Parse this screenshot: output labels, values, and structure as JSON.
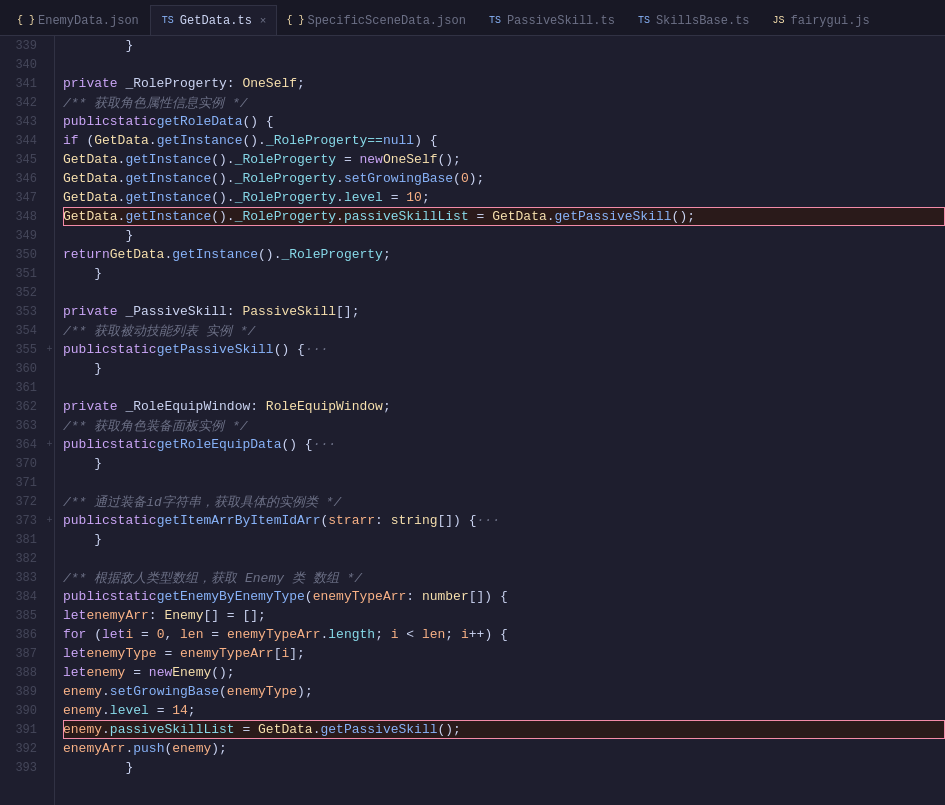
{
  "tabs": [
    {
      "id": "enemydata",
      "label": "EnemyData.json",
      "icon": "json",
      "active": false,
      "closeable": false,
      "color": "#f9e2af"
    },
    {
      "id": "getdata",
      "label": "GetData.ts",
      "icon": "ts",
      "active": true,
      "closeable": true,
      "color": "#89b4fa"
    },
    {
      "id": "specificscenedata",
      "label": "SpecificSceneData.json",
      "icon": "json",
      "active": false,
      "closeable": false,
      "color": "#f9e2af"
    },
    {
      "id": "passiveskill",
      "label": "PassiveSkill.ts",
      "icon": "ts",
      "active": false,
      "closeable": false,
      "color": "#89b4fa"
    },
    {
      "id": "skillsbase",
      "label": "SkillsBase.ts",
      "icon": "ts",
      "active": false,
      "closeable": false,
      "color": "#89b4fa"
    },
    {
      "id": "fairygui",
      "label": "fairygui.js",
      "icon": "js",
      "active": false,
      "closeable": false,
      "color": "#f9e2af"
    }
  ],
  "lines": [
    {
      "num": 339,
      "fold": false,
      "content": "        }"
    },
    {
      "num": 340,
      "fold": false,
      "content": ""
    },
    {
      "num": 341,
      "fold": false,
      "content": "    private _RoleProgerty: OneSelf;"
    },
    {
      "num": 342,
      "fold": false,
      "content": "    /** 获取角色属性信息实例 */"
    },
    {
      "num": 343,
      "fold": false,
      "content": "    public static getRoleData() {"
    },
    {
      "num": 344,
      "fold": false,
      "content": "        if (GetData.getInstance()._RoleProgerty == null) {"
    },
    {
      "num": 345,
      "fold": false,
      "content": "            GetData.getInstance()._RoleProgerty = new OneSelf();"
    },
    {
      "num": 346,
      "fold": false,
      "content": "            GetData.getInstance()._RoleProgerty.setGrowingBase(0);"
    },
    {
      "num": 347,
      "fold": false,
      "content": "            GetData.getInstance()._RoleProgerty.level = 10;"
    },
    {
      "num": 348,
      "fold": false,
      "content": "            GetData.getInstance()._RoleProgerty.passiveSkillList = GetData.getPassiveSkill();",
      "highlight": true
    },
    {
      "num": 349,
      "fold": false,
      "content": "        }"
    },
    {
      "num": 350,
      "fold": false,
      "content": "        return GetData.getInstance()._RoleProgerty;"
    },
    {
      "num": 351,
      "fold": false,
      "content": "    }"
    },
    {
      "num": 352,
      "fold": false,
      "content": ""
    },
    {
      "num": 353,
      "fold": false,
      "content": "    private _PassiveSkill: PassiveSkill[];"
    },
    {
      "num": 354,
      "fold": false,
      "content": "    /** 获取被动技能列表 实例 */"
    },
    {
      "num": 355,
      "fold": true,
      "content": "    public static getPassiveSkill() {···"
    },
    {
      "num": 360,
      "fold": false,
      "content": "    }"
    },
    {
      "num": 361,
      "fold": false,
      "content": ""
    },
    {
      "num": 362,
      "fold": false,
      "content": "    private _RoleEquipWindow: RoleEquipWindow;"
    },
    {
      "num": 363,
      "fold": false,
      "content": "    /** 获取角色装备面板实例 */"
    },
    {
      "num": 364,
      "fold": true,
      "content": "    public static getRoleEquipData() {···"
    },
    {
      "num": 370,
      "fold": false,
      "content": "    }"
    },
    {
      "num": 371,
      "fold": false,
      "content": ""
    },
    {
      "num": 372,
      "fold": false,
      "content": "    /** 通过装备id字符串，获取具体的实例类 */"
    },
    {
      "num": 373,
      "fold": true,
      "content": "    public static getItemArrByItemIdArr(strarr: string[]) {···"
    },
    {
      "num": 381,
      "fold": false,
      "content": "    }"
    },
    {
      "num": 382,
      "fold": false,
      "content": ""
    },
    {
      "num": 383,
      "fold": false,
      "content": "    /** 根据敌人类型数组，获取 Enemy 类 数组 */"
    },
    {
      "num": 384,
      "fold": false,
      "content": "    public static getEnemyByEnemyType(enemyTypeArr: number[]) {"
    },
    {
      "num": 385,
      "fold": false,
      "content": "        let enemyArr: Enemy[] = [];"
    },
    {
      "num": 386,
      "fold": false,
      "content": "        for (let i = 0, len = enemyTypeArr.length; i < len; i++) {"
    },
    {
      "num": 387,
      "fold": false,
      "content": "            let enemyType = enemyTypeArr[i];"
    },
    {
      "num": 388,
      "fold": false,
      "content": "            let enemy = new Enemy();"
    },
    {
      "num": 389,
      "fold": false,
      "content": "            enemy.setGrowingBase(enemyType);"
    },
    {
      "num": 390,
      "fold": false,
      "content": "            enemy.level = 14;"
    },
    {
      "num": 391,
      "fold": false,
      "content": "            enemy.passiveSkillList = GetData.getPassiveSkill();",
      "highlight": true
    },
    {
      "num": 392,
      "fold": false,
      "content": "            enemyArr.push(enemy);"
    },
    {
      "num": 393,
      "fold": false,
      "content": "        }"
    }
  ]
}
